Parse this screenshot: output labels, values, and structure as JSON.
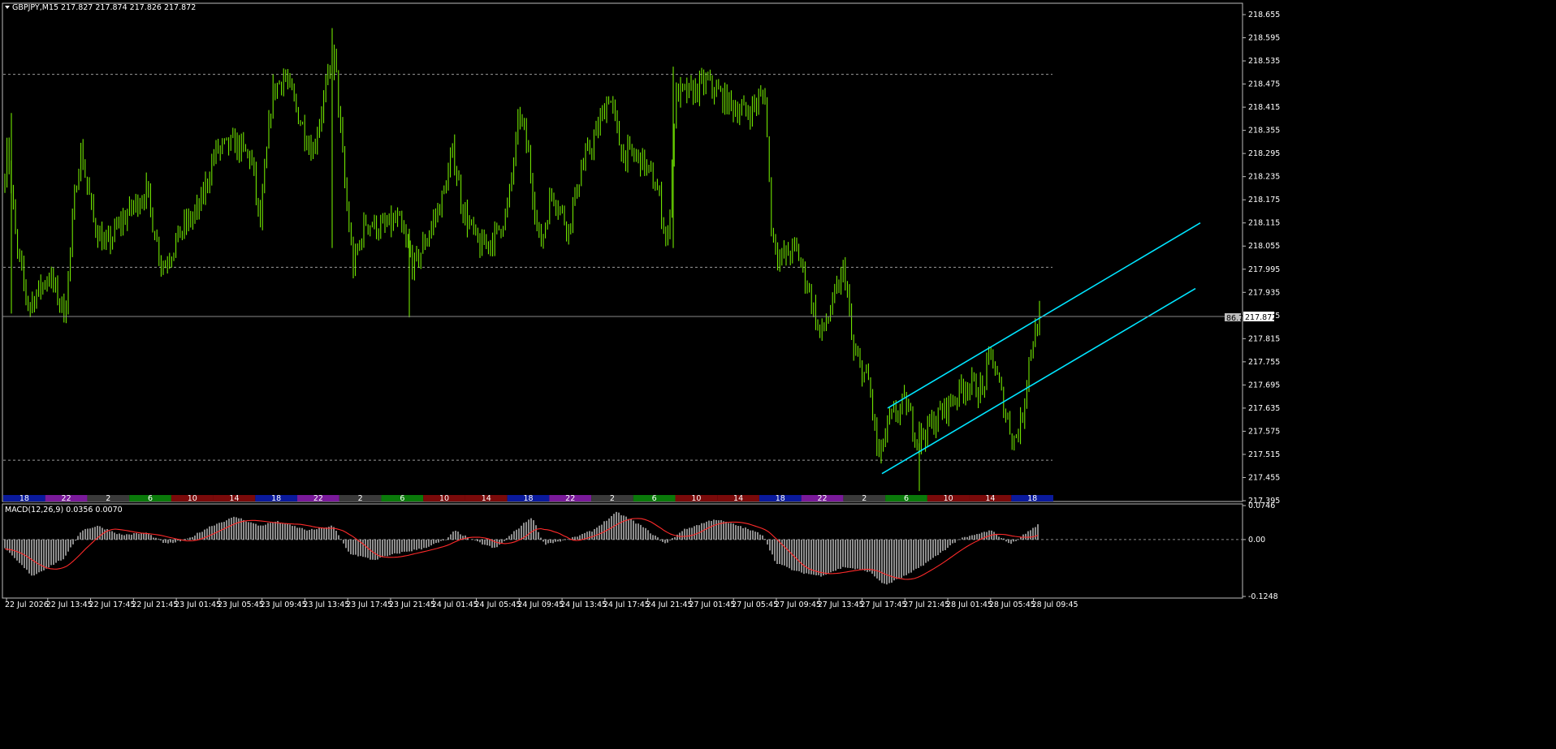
{
  "symbol_header": "GBPJPY,M15  217.827 217.874 217.826 217.872",
  "macd_header": "MACD(12,26,9) 0.0356 0.0070",
  "current_price_label": "217.872",
  "marker_badge": "86.7",
  "colors": {
    "background": "#000000",
    "candles": "#7CFC00",
    "channel": "#00E5FF",
    "grid": "#9a9a9a",
    "macd_hist": "#c8c8c8",
    "signal": "#ff2a2a"
  },
  "price_axis": {
    "labels": [
      "218.655",
      "218.595",
      "218.535",
      "218.475",
      "218.415",
      "218.355",
      "218.295",
      "218.235",
      "218.175",
      "218.115",
      "218.055",
      "217.995",
      "217.935",
      "217.875",
      "217.815",
      "217.755",
      "217.695",
      "217.635",
      "217.575",
      "217.515",
      "217.455",
      "217.395"
    ]
  },
  "macd_axis": {
    "labels": [
      "0.0746",
      "0.00",
      "-0.1248"
    ]
  },
  "time_axis": {
    "labels": [
      "22 Jul 2026",
      "22 Jul 13:45",
      "22 Jul 17:45",
      "22 Jul 21:45",
      "23 Jul 01:45",
      "23 Jul 05:45",
      "23 Jul 09:45",
      "23 Jul 13:45",
      "23 Jul 17:45",
      "23 Jul 21:45",
      "24 Jul 01:45",
      "24 Jul 05:45",
      "24 Jul 09:45",
      "24 Jul 13:45",
      "24 Jul 17:45",
      "24 Jul 21:45",
      "27 Jul 01:45",
      "27 Jul 05:45",
      "27 Jul 09:45",
      "27 Jul 13:45",
      "27 Jul 17:45",
      "27 Jul 21:45",
      "28 Jul 01:45",
      "28 Jul 05:45",
      "28 Jul 09:45"
    ]
  },
  "session_bar": {
    "segments": [
      {
        "label": "18",
        "color": "#0a1a9c"
      },
      {
        "label": "22",
        "color": "#7a1a9a"
      },
      {
        "label": "2",
        "color": "#3a3a3a"
      },
      {
        "label": "6",
        "color": "#0a7a0a"
      },
      {
        "label": "10",
        "color": "#7a0a0a"
      },
      {
        "label": "14",
        "color": "#7a0a0a"
      },
      {
        "label": "18",
        "color": "#0a1a9c"
      },
      {
        "label": "22",
        "color": "#7a1a9a"
      },
      {
        "label": "2",
        "color": "#3a3a3a"
      },
      {
        "label": "6",
        "color": "#0a7a0a"
      },
      {
        "label": "10",
        "color": "#7a0a0a"
      },
      {
        "label": "14",
        "color": "#7a0a0a"
      },
      {
        "label": "18",
        "color": "#0a1a9c"
      },
      {
        "label": "22",
        "color": "#7a1a9a"
      },
      {
        "label": "2",
        "color": "#3a3a3a"
      },
      {
        "label": "6",
        "color": "#0a7a0a"
      },
      {
        "label": "10",
        "color": "#7a0a0a"
      },
      {
        "label": "14",
        "color": "#7a0a0a"
      },
      {
        "label": "18",
        "color": "#0a1a9c"
      },
      {
        "label": "22",
        "color": "#7a1a9a"
      },
      {
        "label": "2",
        "color": "#3a3a3a"
      },
      {
        "label": "6",
        "color": "#0a7a0a"
      },
      {
        "label": "10",
        "color": "#7a0a0a"
      },
      {
        "label": "14",
        "color": "#7a0a0a"
      },
      {
        "label": "18",
        "color": "#0a1a9c"
      }
    ]
  },
  "chart_data": {
    "type": "candlestick",
    "symbol": "GBPJPY",
    "timeframe": "M15",
    "ylim": [
      217.395,
      218.655
    ],
    "last_price": 217.872,
    "ohlc_last": {
      "open": 217.827,
      "high": 217.874,
      "low": 217.826,
      "close": 217.872
    },
    "horizontal_levels": [
      218.5,
      218.0,
      217.5
    ],
    "price_path": [
      [
        0,
        217.95
      ],
      [
        8,
        218.35
      ],
      [
        20,
        218.05
      ],
      [
        35,
        217.9
      ],
      [
        60,
        217.98
      ],
      [
        80,
        217.88
      ],
      [
        95,
        218.25
      ],
      [
        100,
        218.3
      ],
      [
        115,
        218.12
      ],
      [
        130,
        218.05
      ],
      [
        150,
        218.12
      ],
      [
        180,
        218.2
      ],
      [
        200,
        218.0
      ],
      [
        225,
        218.1
      ],
      [
        245,
        218.15
      ],
      [
        265,
        218.3
      ],
      [
        290,
        218.32
      ],
      [
        310,
        218.28
      ],
      [
        320,
        218.1
      ],
      [
        335,
        218.45
      ],
      [
        350,
        218.5
      ],
      [
        370,
        218.38
      ],
      [
        385,
        218.3
      ],
      [
        400,
        218.45
      ],
      [
        412,
        218.55
      ],
      [
        425,
        218.2
      ],
      [
        435,
        218.0
      ],
      [
        450,
        218.12
      ],
      [
        470,
        218.1
      ],
      [
        490,
        218.12
      ],
      [
        510,
        218.0
      ],
      [
        530,
        218.1
      ],
      [
        545,
        218.18
      ],
      [
        558,
        218.3
      ],
      [
        570,
        218.15
      ],
      [
        590,
        218.05
      ],
      [
        610,
        218.08
      ],
      [
        625,
        218.15
      ],
      [
        640,
        218.4
      ],
      [
        650,
        218.3
      ],
      [
        665,
        218.05
      ],
      [
        680,
        218.2
      ],
      [
        700,
        218.1
      ],
      [
        715,
        218.25
      ],
      [
        735,
        218.35
      ],
      [
        750,
        218.45
      ],
      [
        765,
        218.3
      ],
      [
        790,
        218.28
      ],
      [
        810,
        218.2
      ],
      [
        822,
        218.05
      ],
      [
        832,
        218.45
      ],
      [
        850,
        218.45
      ],
      [
        870,
        218.48
      ],
      [
        900,
        218.42
      ],
      [
        920,
        218.4
      ],
      [
        942,
        218.45
      ],
      [
        950,
        218.1
      ],
      [
        960,
        218.02
      ],
      [
        980,
        218.05
      ],
      [
        995,
        217.95
      ],
      [
        1010,
        217.82
      ],
      [
        1025,
        217.9
      ],
      [
        1040,
        218.0
      ],
      [
        1050,
        217.78
      ],
      [
        1070,
        217.7
      ],
      [
        1082,
        217.5
      ],
      [
        1095,
        217.6
      ],
      [
        1115,
        217.65
      ],
      [
        1130,
        217.55
      ],
      [
        1150,
        217.6
      ],
      [
        1170,
        217.65
      ],
      [
        1190,
        217.7
      ],
      [
        1210,
        217.68
      ],
      [
        1220,
        217.78
      ],
      [
        1235,
        217.65
      ],
      [
        1248,
        217.55
      ],
      [
        1258,
        217.6
      ],
      [
        1268,
        217.78
      ],
      [
        1280,
        217.87
      ]
    ],
    "channel_lines": [
      {
        "name": "upper",
        "from": [
          1093,
          217.635
        ],
        "to": [
          1478,
          218.115
        ]
      },
      {
        "name": "lower",
        "from": [
          1086,
          217.465
        ],
        "to": [
          1472,
          217.945
        ]
      }
    ]
  },
  "macd_data": {
    "ylim": [
      -0.1248,
      0.0746
    ],
    "path": [
      [
        0,
        -0.01
      ],
      [
        40,
        -0.08
      ],
      [
        60,
        -0.06
      ],
      [
        80,
        -0.04
      ],
      [
        100,
        0.02
      ],
      [
        120,
        0.03
      ],
      [
        150,
        0.01
      ],
      [
        180,
        0.015
      ],
      [
        205,
        -0.01
      ],
      [
        230,
        0.0
      ],
      [
        260,
        0.03
      ],
      [
        290,
        0.05
      ],
      [
        320,
        0.03
      ],
      [
        340,
        0.04
      ],
      [
        360,
        0.03
      ],
      [
        380,
        0.02
      ],
      [
        410,
        0.03
      ],
      [
        430,
        -0.03
      ],
      [
        460,
        -0.045
      ],
      [
        490,
        -0.03
      ],
      [
        520,
        -0.02
      ],
      [
        550,
        0.0
      ],
      [
        560,
        0.02
      ],
      [
        580,
        0.0
      ],
      [
        610,
        -0.02
      ],
      [
        635,
        0.02
      ],
      [
        655,
        0.05
      ],
      [
        670,
        -0.01
      ],
      [
        700,
        0.0
      ],
      [
        730,
        0.02
      ],
      [
        760,
        0.06
      ],
      [
        790,
        0.03
      ],
      [
        820,
        -0.01
      ],
      [
        840,
        0.02
      ],
      [
        880,
        0.045
      ],
      [
        910,
        0.03
      ],
      [
        940,
        0.01
      ],
      [
        955,
        -0.05
      ],
      [
        980,
        -0.07
      ],
      [
        1010,
        -0.08
      ],
      [
        1040,
        -0.06
      ],
      [
        1070,
        -0.07
      ],
      [
        1090,
        -0.1
      ],
      [
        1120,
        -0.075
      ],
      [
        1150,
        -0.04
      ],
      [
        1180,
        0.0
      ],
      [
        1200,
        0.01
      ],
      [
        1220,
        0.02
      ],
      [
        1245,
        -0.01
      ],
      [
        1268,
        0.02
      ],
      [
        1280,
        0.035
      ]
    ]
  }
}
